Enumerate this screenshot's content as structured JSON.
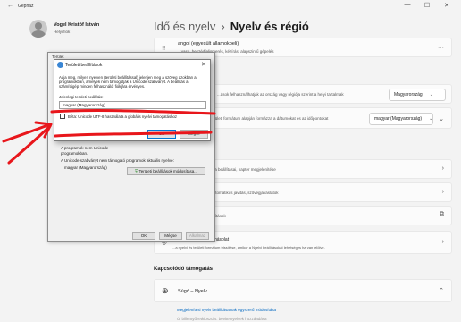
{
  "window": {
    "back_icon": "←",
    "title": "Gépház",
    "minimize": "—",
    "maximize": "☐",
    "close": "✕"
  },
  "user": {
    "name": "Vogel Kristóf István",
    "type": "Helyi fiók"
  },
  "breadcrumb": {
    "parent": "Idő és nyelv",
    "separator": "›",
    "current": "Nyelv és régió"
  },
  "language_card": {
    "title": "angol (egyesült államokbeli)",
    "subtitle": "...vasó, beszédfelismerés, kézírás, alapszintű gépelés",
    "more": "···"
  },
  "country_row": {
    "text": "...ások felhasználhatják az ország vagy régiója szerint a helyi tartalmak",
    "value": "Magyarország",
    "dropdown": "⌄"
  },
  "format_row": {
    "text": "...a területi formátum alapján formázza a dátumokat és az időpontokat",
    "value": "magyar (Magyarország)",
    "dropdown": "⌄",
    "expand": "⌄"
  },
  "rows": [
    {
      "text": "...ra beállításai, napter megjelenítése"
    },
    {
      "text": "...utomatikus javítás, szövegjavaslatok"
    },
    {
      "text": "...llítások"
    }
  ],
  "admin_row": {
    "title": "Windows biztonsági másolat",
    "subtitle": "...a nyelvi és területi formátum frissítése, amikor a Nyelvi beállításokat lehetséges ha van jelölve."
  },
  "related": {
    "title": "Kapcsolódó támogatás",
    "help_title": "Súgó – Nyelv",
    "link1": "Megjelenítési nyelv beállításainak egyszerű módosítása",
    "link2": "Új billentyűzetkiosztás: bevitelnyelvek hozzáadása"
  },
  "legacy_dialog": {
    "title": "Terület",
    "text1": "A programok nem Unicode",
    "text2": "programokban.",
    "text3": "A Unicode szabványt nem támogató programok aktuális nyelve:",
    "text4": "magyar (Magyarország)",
    "change_button": "Területi beállítások módosítása...",
    "ok": "OK",
    "cancel": "Mégse",
    "apply": "Alkalmaz"
  },
  "region_dialog": {
    "title": "Területi beállítások",
    "close": "✕",
    "description": "Adja meg, milyen nyelven (területi beállítással) jelenjen meg a szöveg azokban a programokban, amelyek nem támogatják a Unicode szabványt. A beállítás a számítógép minden felhasználói fiókjára érvényes.",
    "label": "Jelenlegi területi beállítás:",
    "selected": "magyar (Magyarország)",
    "dropdown": "⌄",
    "beta_label": "Béta: Unicode UTF-8 használata a globális nyelvi támogatáshoz",
    "ok": "OK",
    "cancel": "Mégse"
  },
  "annotation_colors": {
    "arrow": "#e8161b",
    "underline": "#e8161b"
  },
  "icons": [
    "back-icon",
    "user-avatar",
    "chevron-right-icon",
    "chevron-down-icon",
    "more-icon",
    "external-link-icon",
    "help-globe-icon",
    "shield-icon",
    "close-icon"
  ]
}
